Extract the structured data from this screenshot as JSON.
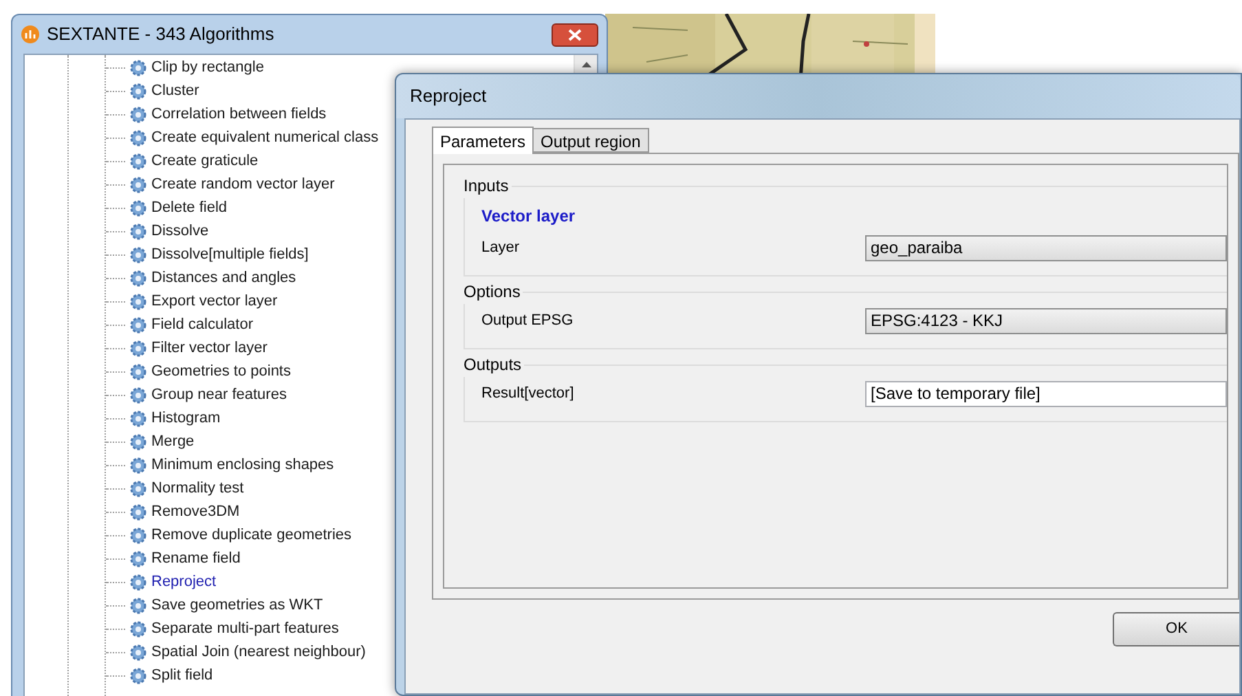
{
  "toolbox": {
    "title": "SEXTANTE - 343 Algorithms",
    "items": [
      {
        "label": "Clip by rectangle",
        "selected": false
      },
      {
        "label": "Cluster",
        "selected": false
      },
      {
        "label": "Correlation between fields",
        "selected": false
      },
      {
        "label": "Create equivalent numerical class",
        "selected": false
      },
      {
        "label": "Create graticule",
        "selected": false
      },
      {
        "label": "Create random vector layer",
        "selected": false
      },
      {
        "label": "Delete field",
        "selected": false
      },
      {
        "label": "Dissolve",
        "selected": false
      },
      {
        "label": "Dissolve[multiple fields]",
        "selected": false
      },
      {
        "label": "Distances and angles",
        "selected": false
      },
      {
        "label": "Export vector layer",
        "selected": false
      },
      {
        "label": "Field calculator",
        "selected": false
      },
      {
        "label": "Filter vector layer",
        "selected": false
      },
      {
        "label": "Geometries to points",
        "selected": false
      },
      {
        "label": "Group near features",
        "selected": false
      },
      {
        "label": "Histogram",
        "selected": false
      },
      {
        "label": "Merge",
        "selected": false
      },
      {
        "label": "Minimum enclosing shapes",
        "selected": false
      },
      {
        "label": "Normality test",
        "selected": false
      },
      {
        "label": "Remove3DM",
        "selected": false
      },
      {
        "label": "Remove duplicate geometries",
        "selected": false
      },
      {
        "label": "Rename field",
        "selected": false
      },
      {
        "label": "Reproject",
        "selected": true
      },
      {
        "label": "Save geometries as WKT",
        "selected": false
      },
      {
        "label": "Separate multi-part features",
        "selected": false
      },
      {
        "label": "Spatial Join (nearest neighbour)",
        "selected": false
      },
      {
        "label": "Split field",
        "selected": false
      }
    ]
  },
  "dialog": {
    "title": "Reproject",
    "tabs": [
      {
        "label": "Parameters",
        "selected": true
      },
      {
        "label": "Output region",
        "selected": false
      }
    ],
    "groups": [
      {
        "title": "Inputs",
        "subtitle": "Vector layer",
        "rows": [
          {
            "label": "Layer",
            "kind": "combo",
            "value": "geo_paraiba"
          }
        ]
      },
      {
        "title": "Options",
        "rows": [
          {
            "label": "Output EPSG",
            "kind": "combo",
            "value": "EPSG:4123 - KKJ"
          }
        ]
      },
      {
        "title": "Outputs",
        "rows": [
          {
            "label": "Result[vector]",
            "kind": "text",
            "value": "[Save to temporary file]"
          }
        ]
      }
    ],
    "buttons": [
      "OK"
    ]
  }
}
